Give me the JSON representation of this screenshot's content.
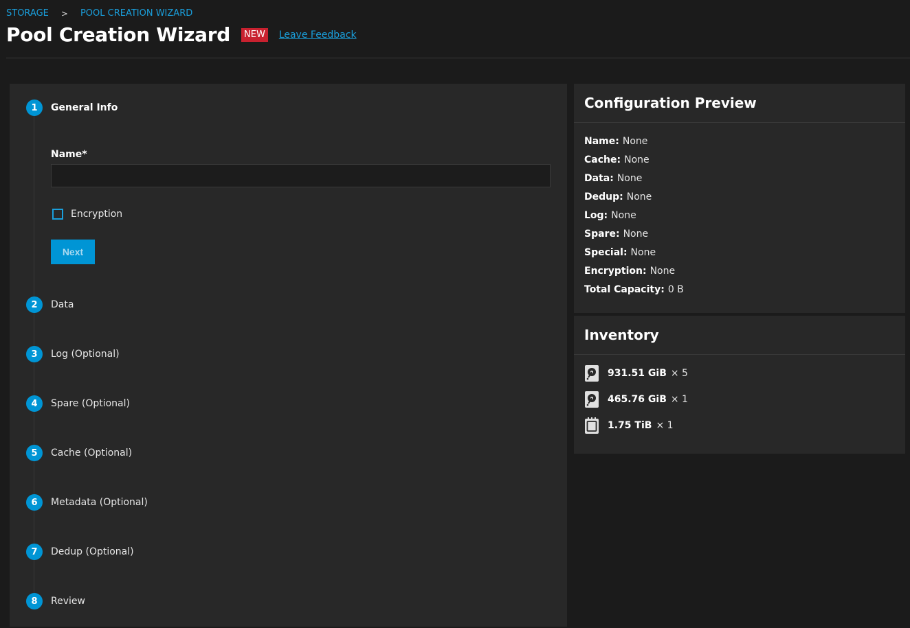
{
  "breadcrumb": {
    "storage": "STORAGE",
    "separator": ">",
    "current": "POOL CREATION WIZARD"
  },
  "header": {
    "title": "Pool Creation Wizard",
    "badge": "NEW",
    "feedback": "Leave Feedback"
  },
  "wizard": {
    "steps": [
      {
        "num": "1",
        "label": "General Info"
      },
      {
        "num": "2",
        "label": "Data"
      },
      {
        "num": "3",
        "label": "Log (Optional)"
      },
      {
        "num": "4",
        "label": "Spare (Optional)"
      },
      {
        "num": "5",
        "label": "Cache (Optional)"
      },
      {
        "num": "6",
        "label": "Metadata (Optional)"
      },
      {
        "num": "7",
        "label": "Dedup (Optional)"
      },
      {
        "num": "8",
        "label": "Review"
      }
    ],
    "name_label": "Name*",
    "name_value": "",
    "encryption_label": "Encryption",
    "next_label": "Next"
  },
  "preview": {
    "title": "Configuration Preview",
    "items": [
      {
        "key": "Name:",
        "value": "None"
      },
      {
        "key": "Cache:",
        "value": "None"
      },
      {
        "key": "Data:",
        "value": "None"
      },
      {
        "key": "Dedup:",
        "value": "None"
      },
      {
        "key": "Log:",
        "value": "None"
      },
      {
        "key": "Spare:",
        "value": "None"
      },
      {
        "key": "Special:",
        "value": "None"
      },
      {
        "key": "Encryption:",
        "value": "None"
      },
      {
        "key": "Total Capacity:",
        "value": "0 B"
      }
    ]
  },
  "inventory": {
    "title": "Inventory",
    "items": [
      {
        "icon": "hdd-icon",
        "size": "931.51 GiB",
        "count": "× 5"
      },
      {
        "icon": "hdd-icon",
        "size": "465.76 GiB",
        "count": "× 1"
      },
      {
        "icon": "ssd-icon",
        "size": "1.75 TiB",
        "count": "× 1"
      }
    ]
  },
  "colors": {
    "accent": "#0095d5",
    "link": "#1a9fdc",
    "badge": "#c8212f",
    "panel": "#282828",
    "background": "#1b1b1b"
  }
}
